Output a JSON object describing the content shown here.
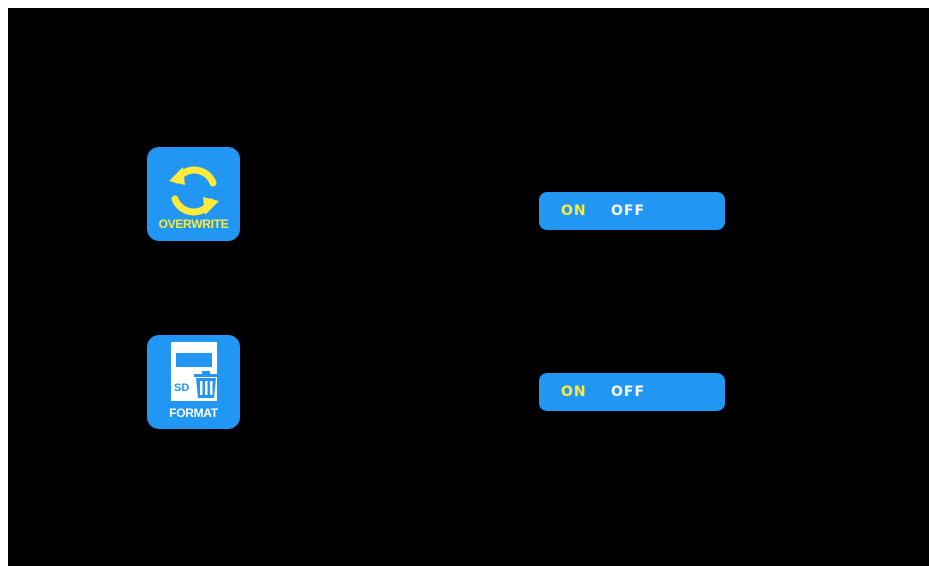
{
  "settings": [
    {
      "id": "overwrite",
      "label": "OVERWRITE",
      "icon": "refresh-arrows-icon",
      "on_label": "ON",
      "off_label": "OFF",
      "selected": "ON"
    },
    {
      "id": "format",
      "label": "FORMAT",
      "icon": "sd-card-trash-icon",
      "card_text": "SD",
      "on_label": "ON",
      "off_label": "OFF",
      "selected": "ON"
    }
  ],
  "colors": {
    "background": "#000000",
    "tile": "#2196f3",
    "selected_text": "#ffeb3b",
    "unselected_text": "#ffffff"
  }
}
